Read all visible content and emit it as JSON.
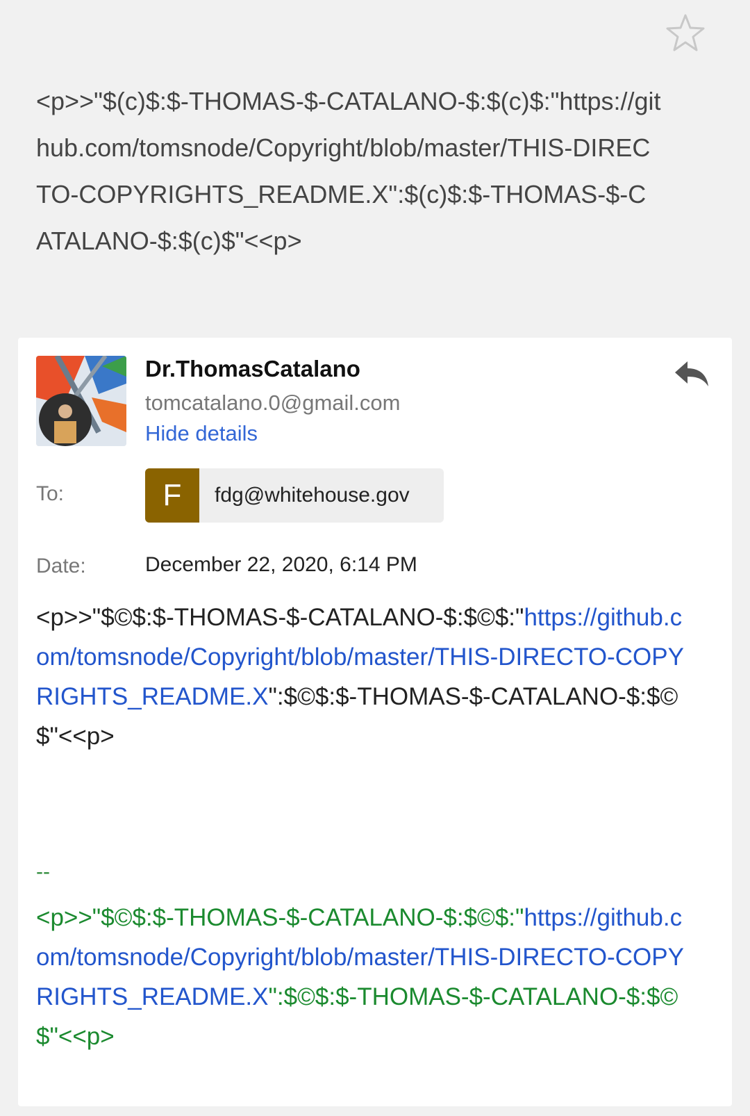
{
  "subject": "<p>>\"$(c)$:$-THOMAS-$-CATALANO-$:$(c)$:\"https://github.com/tomsnode/Copyright/blob/master/THIS-DIRECTO-COPYRIGHTS_README.X\":$(c)$:$-THOMAS-$-CATALANO-$:$(c)$\"<<p>",
  "sender": {
    "name": "Dr.ThomasCatalano",
    "email": "tomcatalano.0@gmail.com",
    "hide_details": "Hide details"
  },
  "details": {
    "to_label": "To:",
    "recipient_initial": "F",
    "recipient_email": "fdg@whitehouse.gov",
    "date_label": "Date:",
    "date_value": "December 22, 2020, 6:14 PM"
  },
  "body": {
    "prefix": "<p>>\"$©$:$-THOMAS-$-CATALANO-$:$©$:\"",
    "link": "https://github.com/tomsnode/Copyright/blob/master/THIS-DIRECTO-COPYRIGHTS_README.X",
    "suffix": "\":$©$:$-THOMAS-$-CATALANO-$:$©$\"<<p>"
  },
  "signature": {
    "dash": "--",
    "prefix": "<p>>\"$©$:$-THOMAS-$-CATALANO-$:$©$:\"",
    "link": "https://github.com/tomsnode/Copyright/blob/master/THIS-DIRECTO-COPYRIGHTS_README.X",
    "suffix": "\":$©$:$-THOMAS-$-CATALANO-$:$©$\"<<p>"
  },
  "colors": {
    "link": "#2255cc",
    "signature_green": "#1b8a2f",
    "chip_letter_bg": "#8a6300",
    "hide_details": "#3367d6"
  },
  "icons": {
    "star": "star-icon",
    "reply": "reply-icon"
  }
}
